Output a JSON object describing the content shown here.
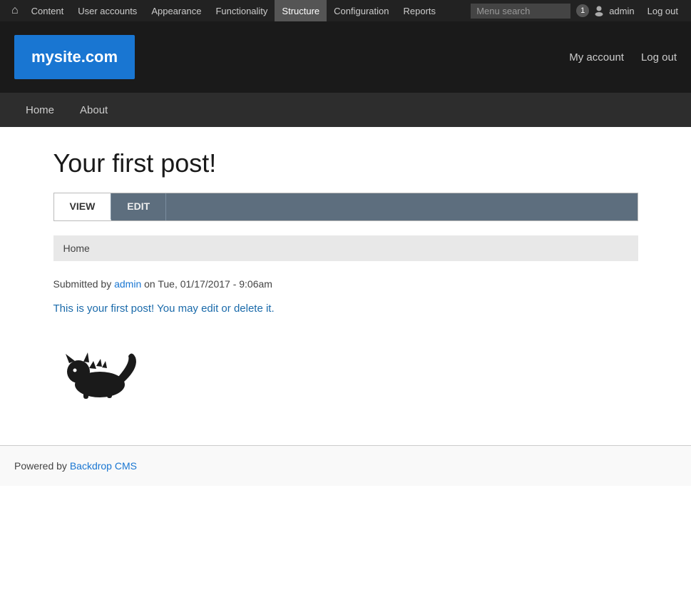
{
  "admin_toolbar": {
    "home_icon": "⌂",
    "items": [
      {
        "label": "Content",
        "name": "content"
      },
      {
        "label": "User accounts",
        "name": "user-accounts"
      },
      {
        "label": "Appearance",
        "name": "appearance"
      },
      {
        "label": "Functionality",
        "name": "functionality"
      },
      {
        "label": "Structure",
        "name": "structure"
      },
      {
        "label": "Configuration",
        "name": "configuration"
      },
      {
        "label": "Reports",
        "name": "reports"
      }
    ],
    "search_placeholder": "Menu search",
    "user_count": "1",
    "admin_label": "admin",
    "logout_label": "Log out"
  },
  "site_header": {
    "logo_text": "mysite.com",
    "links": [
      {
        "label": "My account",
        "name": "my-account"
      },
      {
        "label": "Log out",
        "name": "header-logout"
      }
    ]
  },
  "main_nav": {
    "items": [
      {
        "label": "Home",
        "name": "nav-home"
      },
      {
        "label": "About",
        "name": "nav-about"
      }
    ]
  },
  "page": {
    "title": "Your first post!",
    "tabs": [
      {
        "label": "VIEW",
        "name": "tab-view",
        "active": true
      },
      {
        "label": "EDIT",
        "name": "tab-edit",
        "active": false
      }
    ],
    "breadcrumb": "Home",
    "submitted_prefix": "Submitted by ",
    "submitted_user": "admin",
    "submitted_suffix": " on Tue, 01/17/2017 - 9:06am",
    "post_body": "This is your first post! You may edit or delete it.",
    "footer_prefix": "Powered by ",
    "footer_link_label": "Backdrop CMS"
  }
}
